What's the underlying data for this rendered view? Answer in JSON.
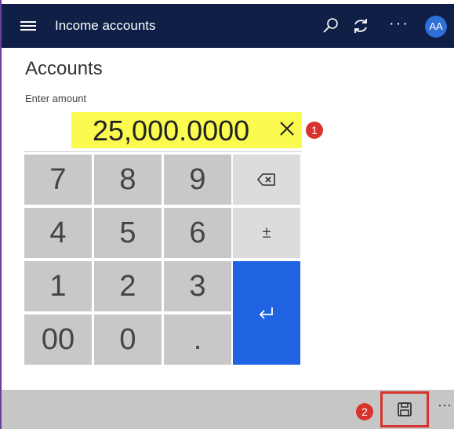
{
  "app": {
    "title": "Income accounts"
  },
  "topbar": {
    "search_icon": "search-icon",
    "refresh_icon": "refresh-icon",
    "more_label": "···",
    "avatar_initials": "AA"
  },
  "page": {
    "title": "Accounts",
    "amount_label": "Enter amount",
    "amount_value": "25,000.0000"
  },
  "callouts": {
    "one": "1",
    "two": "2"
  },
  "keypad": {
    "k7": "7",
    "k8": "8",
    "k9": "9",
    "backspace_icon": "backspace-icon",
    "k4": "4",
    "k5": "5",
    "k6": "6",
    "sign": "±",
    "k1": "1",
    "k2": "2",
    "k3": "3",
    "enter_icon": "enter-icon",
    "k00": "00",
    "k0": "0",
    "decimal": "."
  },
  "bottombar": {
    "save_icon": "save-icon",
    "more_label": "···"
  },
  "colors": {
    "topbar_bg": "#0f1f46",
    "highlight": "#fbfb4f",
    "enter_key": "#1f63e2",
    "callout_red": "#d9342b",
    "avatar": "#2f6fd8"
  }
}
